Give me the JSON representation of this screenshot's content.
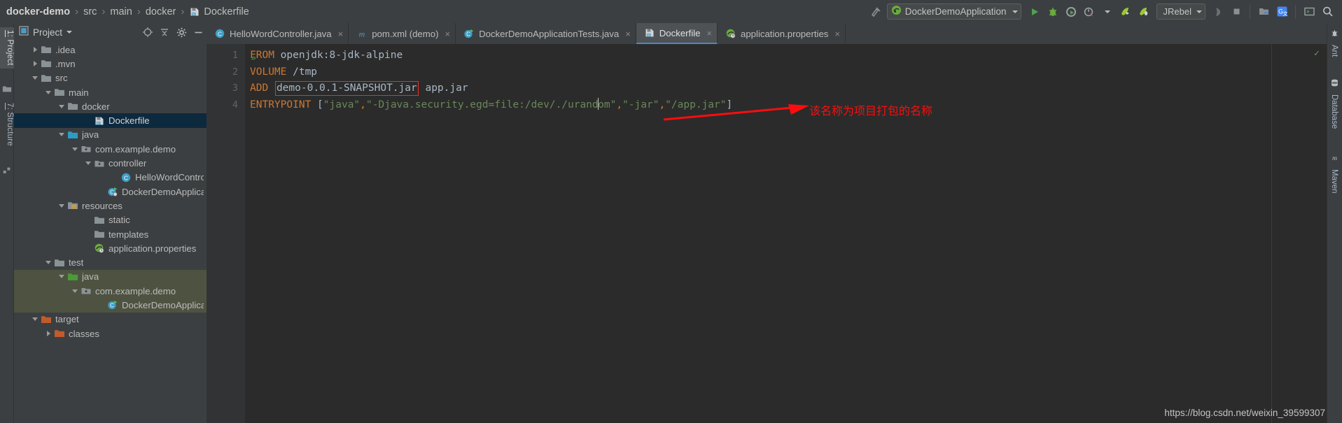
{
  "toolbar": {
    "breadcrumb": [
      {
        "label": "docker-demo",
        "icon": "none",
        "bold": true
      },
      {
        "label": "src",
        "icon": "none",
        "bold": false
      },
      {
        "label": "main",
        "icon": "none",
        "bold": false
      },
      {
        "label": "docker",
        "icon": "none",
        "bold": false
      },
      {
        "label": "Dockerfile",
        "icon": "dockerfile-icon",
        "bold": false
      }
    ],
    "separator": "›",
    "run_config": {
      "label": "DockerDemoApplication",
      "icon": "spring-boot-icon",
      "dropdown": "▼"
    },
    "jrebel": {
      "label": "JRebel",
      "dropdown": "▼"
    },
    "buttons": [
      {
        "name": "build-hammer-icon"
      },
      {
        "name": "run-icon"
      },
      {
        "name": "debug-icon"
      },
      {
        "name": "run-coverage-icon"
      },
      {
        "name": "profiler-icon"
      },
      {
        "name": "jrebel-run-icon"
      },
      {
        "name": "jrebel-debug-icon"
      },
      {
        "name": "update-app-icon"
      },
      {
        "name": "stop-icon"
      },
      {
        "name": "project-structure-icon"
      },
      {
        "name": "translate-icon"
      },
      {
        "name": "terminal-icon"
      },
      {
        "name": "search-everywhere-icon"
      }
    ]
  },
  "left_tool_window": {
    "tabs": [
      {
        "num": "1:",
        "label": " Project",
        "active": true,
        "icon": "project-icon"
      },
      {
        "num": "7:",
        "label": " Structure",
        "active": false,
        "icon": "structure-icon"
      }
    ]
  },
  "right_tool_window": {
    "tabs": [
      {
        "label": "Ant",
        "icon": "ant-icon"
      },
      {
        "label": "Database",
        "icon": "database-icon"
      },
      {
        "label": "Maven",
        "icon": "maven-icon"
      }
    ]
  },
  "project_panel": {
    "title": "Project",
    "title_dropdown": "▼",
    "header_buttons": [
      {
        "name": "locate-icon"
      },
      {
        "name": "collapse-all-icon"
      },
      {
        "name": "settings-gear-icon"
      },
      {
        "name": "hide-icon"
      }
    ],
    "tree": [
      {
        "label": ".idea",
        "indent": 1,
        "arrow": "right",
        "icon": "folder",
        "state": "normal"
      },
      {
        "label": ".mvn",
        "indent": 1,
        "arrow": "right",
        "icon": "folder",
        "state": "normal"
      },
      {
        "label": "src",
        "indent": 1,
        "arrow": "down",
        "icon": "folder",
        "state": "normal"
      },
      {
        "label": "main",
        "indent": 2,
        "arrow": "down",
        "icon": "folder",
        "state": "normal"
      },
      {
        "label": "docker",
        "indent": 3,
        "arrow": "down",
        "icon": "folder",
        "state": "normal"
      },
      {
        "label": "Dockerfile",
        "indent": 5,
        "arrow": "none",
        "icon": "dockerfile",
        "state": "selected"
      },
      {
        "label": "java",
        "indent": 3,
        "arrow": "down",
        "icon": "folder-source",
        "state": "normal"
      },
      {
        "label": "com.example.demo",
        "indent": 4,
        "arrow": "down",
        "icon": "package",
        "state": "normal"
      },
      {
        "label": "controller",
        "indent": 5,
        "arrow": "down",
        "icon": "package",
        "state": "normal"
      },
      {
        "label": "HelloWordController",
        "indent": 7,
        "arrow": "none",
        "icon": "class",
        "state": "normal"
      },
      {
        "label": "DockerDemoApplication",
        "indent": 6,
        "arrow": "none",
        "icon": "class-run",
        "state": "normal"
      },
      {
        "label": "resources",
        "indent": 3,
        "arrow": "down",
        "icon": "folder-res",
        "state": "normal"
      },
      {
        "label": "static",
        "indent": 5,
        "arrow": "none",
        "icon": "folder",
        "state": "normal"
      },
      {
        "label": "templates",
        "indent": 5,
        "arrow": "none",
        "icon": "folder",
        "state": "normal"
      },
      {
        "label": "application.properties",
        "indent": 5,
        "arrow": "none",
        "icon": "spring-prop",
        "state": "normal"
      },
      {
        "label": "test",
        "indent": 2,
        "arrow": "down",
        "icon": "folder",
        "state": "normal"
      },
      {
        "label": "java",
        "indent": 3,
        "arrow": "down",
        "icon": "folder-test",
        "state": "greenbg"
      },
      {
        "label": "com.example.demo",
        "indent": 4,
        "arrow": "down",
        "icon": "package",
        "state": "greenbg"
      },
      {
        "label": "DockerDemoApplicationT",
        "indent": 6,
        "arrow": "none",
        "icon": "class-test",
        "state": "greenbg"
      },
      {
        "label": "target",
        "indent": 1,
        "arrow": "down",
        "icon": "folder-target",
        "state": "normal"
      },
      {
        "label": "classes",
        "indent": 2,
        "arrow": "right",
        "icon": "folder-target",
        "state": "normal"
      }
    ]
  },
  "editor": {
    "tabs": [
      {
        "label": "HelloWordController.java",
        "icon": "java-class-icon",
        "active": false,
        "close": "×"
      },
      {
        "label": "pom.xml (demo)",
        "icon": "maven-m-icon",
        "active": false,
        "close": "×"
      },
      {
        "label": "DockerDemoApplicationTests.java",
        "icon": "java-test-icon",
        "active": false,
        "close": "×"
      },
      {
        "label": "Dockerfile",
        "icon": "dockerfile-icon",
        "active": true,
        "close": "×"
      },
      {
        "label": "application.properties",
        "icon": "spring-prop-icon",
        "active": false,
        "close": "×"
      }
    ],
    "line_numbers": [
      "1",
      "2",
      "3",
      "4"
    ],
    "lines": [
      {
        "tokens": [
          {
            "t": "FROM",
            "c": "kw"
          },
          {
            "t": " openjdk:8-jdk-alpine",
            "c": "plain"
          }
        ]
      },
      {
        "tokens": [
          {
            "t": "VOLUME",
            "c": "kw"
          },
          {
            "t": " /tmp",
            "c": "plain"
          }
        ]
      },
      {
        "tokens": [
          {
            "t": "ADD",
            "c": "kw"
          },
          {
            "t": " ",
            "c": "plain"
          },
          {
            "t": "demo-0.0.1-SNAPSHOT.jar",
            "c": "boxed"
          },
          {
            "t": " app.jar",
            "c": "plain"
          }
        ]
      },
      {
        "tokens": [
          {
            "t": "ENTRYPOINT",
            "c": "kw"
          },
          {
            "t": " [",
            "c": "punct"
          },
          {
            "t": "\"java\"",
            "c": "str"
          },
          {
            "t": ",",
            "c": "kw"
          },
          {
            "t": "\"-Djava.security.egd=file:/dev/./urand",
            "c": "str"
          },
          {
            "t": "caret",
            "c": "caret"
          },
          {
            "t": "om\"",
            "c": "str"
          },
          {
            "t": ",",
            "c": "kw"
          },
          {
            "t": "\"-jar\"",
            "c": "str"
          },
          {
            "t": ",",
            "c": "kw"
          },
          {
            "t": "\"/app.jar\"",
            "c": "str"
          },
          {
            "t": "]",
            "c": "punct"
          }
        ]
      }
    ],
    "run_gutter_marker": "»",
    "inspection_ok": "✓"
  },
  "annotation": {
    "text": "该名称为项目打包的名称",
    "color": "#fb0d0d",
    "arrow_name": "red-arrow"
  },
  "watermark": {
    "text": "https://blog.csdn.net/weixin_39599307"
  },
  "colors": {
    "chrome": "#3c3f41",
    "editor_bg": "#2b2b2b",
    "gutter_bg": "#313335",
    "selection": "#0d293e",
    "test_green": "#4e5341",
    "keyword": "#cc7832",
    "string": "#6a8759",
    "text": "#a9b7c6",
    "accent_red": "#e8312a"
  }
}
